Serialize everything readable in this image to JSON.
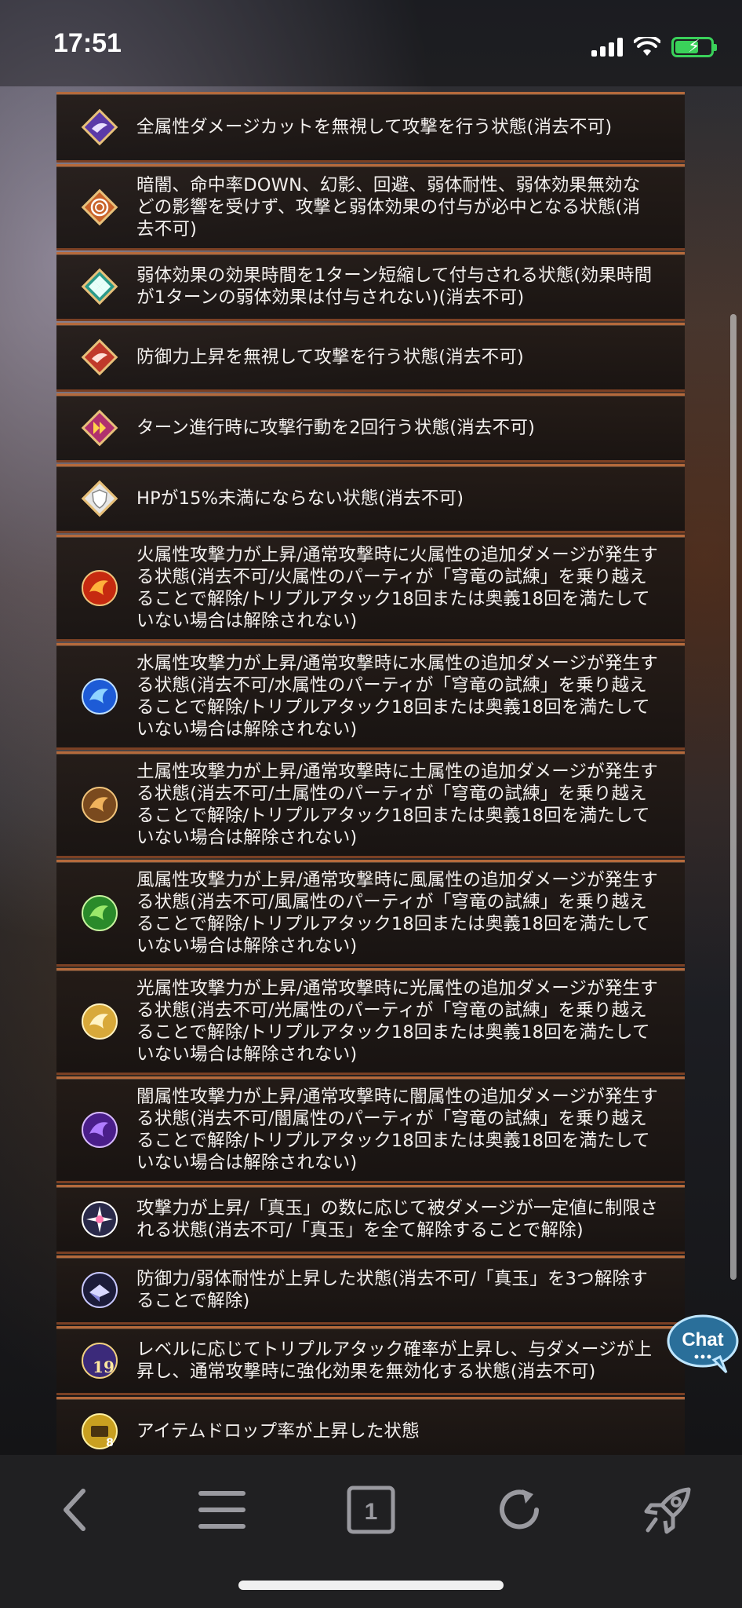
{
  "status_bar": {
    "time": "17:51"
  },
  "colors": {
    "row_border_top": "#b56a3c",
    "row_border_bottom": "#7a4024",
    "battery": "#3ad15a",
    "nav_icon": "#9a9aa0"
  },
  "list": {
    "items": [
      {
        "icon": "purple-wings-icon",
        "text": "全属性ダメージカットを無視して攻撃を行う状態(消去不可)"
      },
      {
        "icon": "orange-spiral-icon",
        "text": "暗闇、命中率DOWN、幻影、回避、弱体耐性、弱体効果無効などの影響を受けず、攻撃と弱体効果の付与が必中となる状態(消去不可)"
      },
      {
        "icon": "teal-diamond-icon",
        "text": "弱体効果の効果時間を1ターン短縮して付与される状態(効果時間が1ターンの弱体効果は付与されない)(消去不可)"
      },
      {
        "icon": "red-wings-icon",
        "text": "防御力上昇を無視して攻撃を行う状態(消去不可)"
      },
      {
        "icon": "double-arrow-icon",
        "text": "ターン進行時に攻撃行動を2回行う状態(消去不可)"
      },
      {
        "icon": "white-shield-icon",
        "text": "HPが15%未満にならない状態(消去不可)"
      },
      {
        "icon": "fire-orb-icon",
        "text": "火属性攻撃力が上昇/通常攻撃時に火属性の追加ダメージが発生する状態(消去不可/火属性のパーティが「穹竜の試練」を乗り越えることで解除/トリプルアタック18回または奥義18回を満たしていない場合は解除されない)"
      },
      {
        "icon": "water-orb-icon",
        "text": "水属性攻撃力が上昇/通常攻撃時に水属性の追加ダメージが発生する状態(消去不可/水属性のパーティが「穹竜の試練」を乗り越えることで解除/トリプルアタック18回または奥義18回を満たしていない場合は解除されない)"
      },
      {
        "icon": "earth-orb-icon",
        "text": "土属性攻撃力が上昇/通常攻撃時に土属性の追加ダメージが発生する状態(消去不可/土属性のパーティが「穹竜の試練」を乗り越えることで解除/トリプルアタック18回または奥義18回を満たしていない場合は解除されない)"
      },
      {
        "icon": "wind-orb-icon",
        "text": "風属性攻撃力が上昇/通常攻撃時に風属性の追加ダメージが発生する状態(消去不可/風属性のパーティが「穹竜の試練」を乗り越えることで解除/トリプルアタック18回または奥義18回を満たしていない場合は解除されない)"
      },
      {
        "icon": "light-orb-icon",
        "text": "光属性攻撃力が上昇/通常攻撃時に光属性の追加ダメージが発生する状態(消去不可/光属性のパーティが「穹竜の試練」を乗り越えることで解除/トリプルアタック18回または奥義18回を満たしていない場合は解除されない)"
      },
      {
        "icon": "dark-orb-icon",
        "text": "闇属性攻撃力が上昇/通常攻撃時に闇属性の追加ダメージが発生する状態(消去不可/闇属性のパーティが「穹竜の試練」を乗り越えることで解除/トリプルアタック18回または奥義18回を満たしていない場合は解除されない)"
      },
      {
        "icon": "rainbow-orb-icon",
        "text": "攻撃力が上昇/「真玉」の数に応じて被ダメージが一定値に制限される状態(消去不可/「真玉」を全て解除することで解除)"
      },
      {
        "icon": "crystal-orb-icon",
        "text": "防御力/弱体耐性が上昇した状態(消去不可/「真玉」を3つ解除することで解除)"
      },
      {
        "icon": "level-19-icon",
        "badge": "19",
        "text": "レベルに応じてトリプルアタック確率が上昇し、与ダメージが上昇し、通常攻撃時に強化効果を無効化する状態(消去不可)"
      },
      {
        "icon": "item-drop-icon",
        "badge": "8",
        "text": "アイテムドロップ率が上昇した状態"
      }
    ]
  },
  "chat_button": {
    "label": "Chat"
  },
  "bottom_nav": {
    "tab_count": "1",
    "buttons": [
      "back-icon",
      "menu-icon",
      "tabs-icon",
      "reload-icon",
      "rocket-icon"
    ]
  }
}
